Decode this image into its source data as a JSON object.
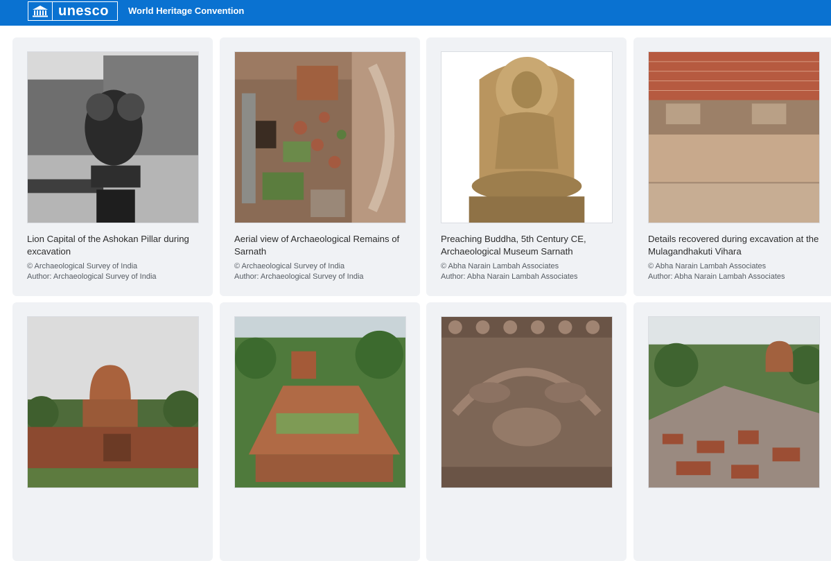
{
  "header": {
    "logo_text": "unesco",
    "site_title": "World Heritage Convention"
  },
  "gallery": {
    "items": [
      {
        "caption": "Lion Capital of the Ashokan Pillar during excavation",
        "copyright": "© Archaeological Survey of India",
        "author": "Author: Archaeological Survey of India"
      },
      {
        "caption": "Aerial view of Archaeological Remains of Sarnath",
        "copyright": "© Archaeological Survey of India",
        "author": "Author: Archaeological Survey of India"
      },
      {
        "caption": "Preaching Buddha, 5th Century CE, Archaeological Museum Sarnath",
        "copyright": "© Abha Narain Lambah Associates",
        "author": "Author: Abha Narain Lambah Associates"
      },
      {
        "caption": "Details recovered during excavation at the Mulagandhakuti Vihara",
        "copyright": "© Abha Narain Lambah Associates",
        "author": "Author: Abha Narain Lambah Associates"
      },
      {
        "caption": "",
        "copyright": "",
        "author": ""
      },
      {
        "caption": "",
        "copyright": "",
        "author": ""
      },
      {
        "caption": "",
        "copyright": "",
        "author": ""
      },
      {
        "caption": "",
        "copyright": "",
        "author": ""
      }
    ]
  },
  "colors": {
    "header_bg": "#0a72d1",
    "card_bg": "#f0f2f5"
  }
}
